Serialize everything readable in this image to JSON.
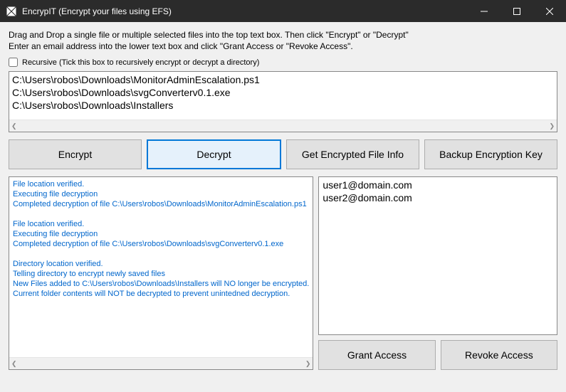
{
  "titlebar": {
    "title": "EncrypIT (Encrypt your files using EFS)"
  },
  "instructions": {
    "line1": "Drag and Drop a single file or multiple selected files into the top text box. Then click \"Encrypt\" or \"Decrypt\"",
    "line2": "Enter an email address into the lower text box and click \"Grant Access or \"Revoke Access\"."
  },
  "recursive": {
    "label": "Recursive (Tick this box to recursively encrypt or decrypt a directory)",
    "checked": false
  },
  "filepaths": "C:\\Users\\robos\\Downloads\\MonitorAdminEscalation.ps1\nC:\\Users\\robos\\Downloads\\svgConverterv0.1.exe\nC:\\Users\\robos\\Downloads\\Installers",
  "buttons": {
    "encrypt": "Encrypt",
    "decrypt": "Decrypt",
    "getinfo": "Get Encrypted File Info",
    "backup": "Backup Encryption Key",
    "grant": "Grant Access",
    "revoke": "Revoke Access"
  },
  "log": "File location verified.\nExecuting file decryption\nCompleted decryption of file C:\\Users\\robos\\Downloads\\MonitorAdminEscalation.ps1\n\nFile location verified.\nExecuting file decryption\nCompleted decryption of file C:\\Users\\robos\\Downloads\\svgConverterv0.1.exe\n\nDirectory location verified.\nTelling directory to encrypt newly saved files\nNew Files added to C:\\Users\\robos\\Downloads\\Installers will NO longer be encrypted.\nCurrent folder contents will NOT be decrypted to prevent unintedned decryption.",
  "emails": "user1@domain.com\nuser2@domain.com"
}
